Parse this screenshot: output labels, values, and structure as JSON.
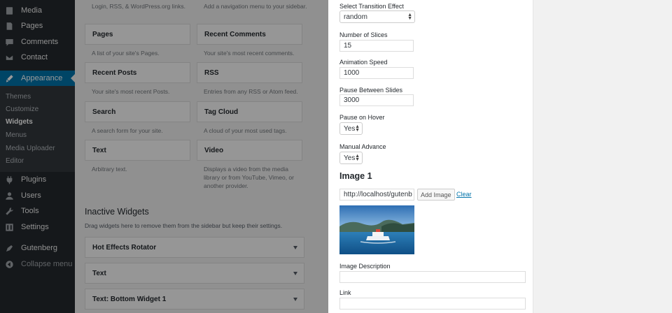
{
  "sidebar": {
    "items": [
      {
        "label": "Media",
        "icon": "media-icon"
      },
      {
        "label": "Pages",
        "icon": "pages-icon"
      },
      {
        "label": "Comments",
        "icon": "comments-icon"
      },
      {
        "label": "Contact",
        "icon": "contact-icon"
      },
      {
        "label": "Appearance",
        "icon": "appearance-icon"
      },
      {
        "label": "Plugins",
        "icon": "plugins-icon"
      },
      {
        "label": "Users",
        "icon": "users-icon"
      },
      {
        "label": "Tools",
        "icon": "tools-icon"
      },
      {
        "label": "Settings",
        "icon": "settings-icon"
      },
      {
        "label": "Gutenberg",
        "icon": "gutenberg-icon"
      },
      {
        "label": "Collapse menu",
        "icon": "collapse-icon"
      }
    ],
    "submenu": [
      "Themes",
      "Customize",
      "Widgets",
      "Menus",
      "Media Uploader",
      "Editor"
    ]
  },
  "widgets": {
    "top_descs": [
      "Login, RSS, & WordPress.org links.",
      "Add a navigation menu to your sidebar."
    ],
    "available": [
      {
        "title": "Pages",
        "desc": "A list of your site's Pages."
      },
      {
        "title": "Recent Comments",
        "desc": "Your site's most recent comments."
      },
      {
        "title": "Recent Posts",
        "desc": "Your site's most recent Posts."
      },
      {
        "title": "RSS",
        "desc": "Entries from any RSS or Atom feed."
      },
      {
        "title": "Search",
        "desc": "A search form for your site."
      },
      {
        "title": "Tag Cloud",
        "desc": "A cloud of your most used tags."
      },
      {
        "title": "Text",
        "desc": "Arbitrary text."
      },
      {
        "title": "Video",
        "desc": "Displays a video from the media library or from YouTube, Vimeo, or another provider."
      }
    ],
    "inactive_title": "Inactive Widgets",
    "inactive_desc": "Drag widgets here to remove them from the sidebar but keep their settings.",
    "inactive": [
      "Hot Effects Rotator",
      "Text",
      "Text: Bottom Widget 1"
    ]
  },
  "panel": {
    "transition_label": "Select Transition Effect",
    "transition_value": "random",
    "slices_label": "Number of Slices",
    "slices_value": "15",
    "speed_label": "Animation Speed",
    "speed_value": "1000",
    "pause_label": "Pause Between Slides",
    "pause_value": "3000",
    "hover_label": "Pause on Hover",
    "hover_value": "Yes",
    "manual_label": "Manual Advance",
    "manual_value": "Yes",
    "image_heading": "Image 1",
    "image_url": "http://localhost/gutenb",
    "add_image": "Add Image",
    "clear": "Clear",
    "desc_label": "Image Description",
    "link_label": "Link"
  },
  "colors": {
    "sidebar_bg": "#23282d",
    "active_bg": "#0073aa",
    "link": "#0073aa"
  }
}
